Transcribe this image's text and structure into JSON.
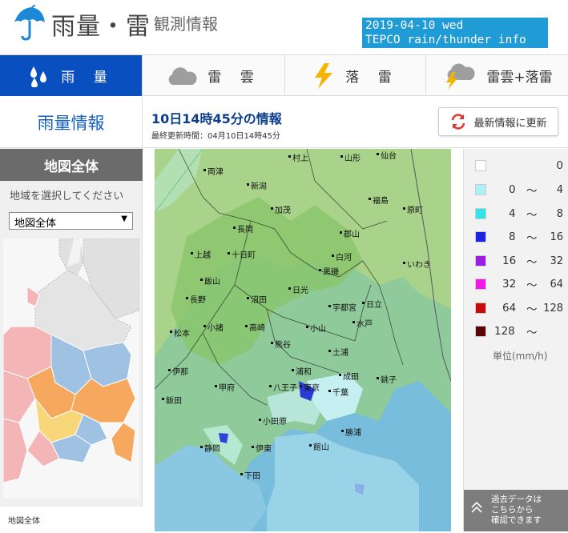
{
  "header": {
    "title": "雨量・雷",
    "subtitle": "観測情報",
    "info_line1": "2019-04-10 wed",
    "info_line2": "TEPCO rain/thunder info"
  },
  "tabs": [
    {
      "label": "雨 量",
      "icon": "rain-drops-icon",
      "active": true
    },
    {
      "label": "雷 雲",
      "icon": "cloud-icon",
      "active": false
    },
    {
      "label": "落 雷",
      "icon": "lightning-bolt-icon",
      "active": false
    },
    {
      "label": "雷雲+落雷",
      "icon": "cloud-lightning-icon",
      "active": false
    }
  ],
  "sidebar": {
    "section_title": "雨量情報",
    "map_header": "地図全体",
    "region_label": "地域を選択してください",
    "region_selected": "地図全体",
    "mini_map_caption": "地図全体"
  },
  "main": {
    "info_time": "10日14時45分の情報",
    "last_update": "最終更新時間：04月10日14時45分",
    "update_button": "最新情報に更新"
  },
  "map_cities": [
    "村上",
    "山形",
    "仙台",
    "両津",
    "新潟",
    "福島",
    "原町",
    "加茂",
    "長岡",
    "郡山",
    "上越",
    "十日町",
    "白河",
    "いわき",
    "飯山",
    "黒磯",
    "長野",
    "沼田",
    "日光",
    "宇都宮",
    "日立",
    "松本",
    "小諸",
    "高崎",
    "小山",
    "水戸",
    "熊谷",
    "土浦",
    "伊那",
    "浦和",
    "成田",
    "銚子",
    "飯田",
    "甲府",
    "八王子",
    "東京",
    "千葉",
    "小田原",
    "勝浦",
    "静岡",
    "伊東",
    "館山",
    "下田"
  ],
  "legend": {
    "rows": [
      {
        "from": "",
        "to": "0",
        "color": "#ffffff"
      },
      {
        "from": "0",
        "to": "4",
        "color": "#aaf0f5"
      },
      {
        "from": "4",
        "to": "8",
        "color": "#2de5e8"
      },
      {
        "from": "8",
        "to": "16",
        "color": "#1e22e0"
      },
      {
        "from": "16",
        "to": "32",
        "color": "#9b1ee0"
      },
      {
        "from": "32",
        "to": "64",
        "color": "#f516e8"
      },
      {
        "from": "64",
        "to": "128",
        "color": "#c80a0a"
      },
      {
        "from": "128",
        "to": "",
        "color": "#5a0505"
      }
    ],
    "unit": "単位(mm/h)",
    "past_data_line1": "過去データは",
    "past_data_line2": "こちらから",
    "past_data_line3": "確認できます"
  },
  "colors": {
    "accent": "#0a4fc0",
    "info_box": "#1f9bd6",
    "title_blue": "#1560bd"
  }
}
